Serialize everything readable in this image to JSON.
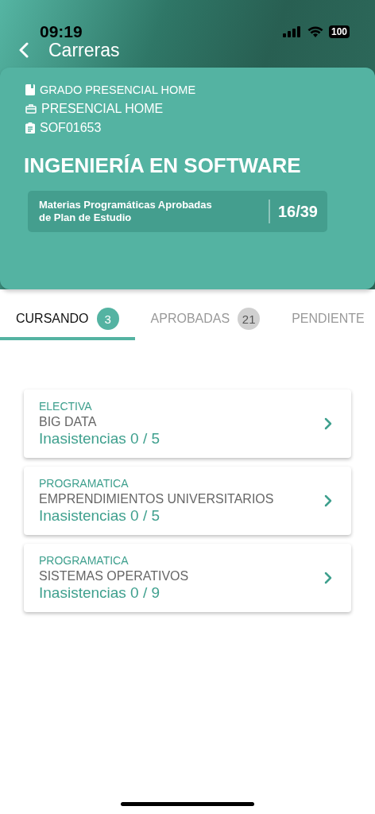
{
  "status_bar": {
    "time": "09:19",
    "battery": "100"
  },
  "nav": {
    "title": "Carreras"
  },
  "program": {
    "details": [
      {
        "kind": "book",
        "text": "GRADO PRESENCIAL HOME"
      },
      {
        "kind": "briefcase",
        "text": "PRESENCIAL HOME"
      },
      {
        "kind": "clipboard",
        "text": "SOF01653"
      }
    ],
    "name": "INGENIERÍA EN SOFTWARE",
    "summary": {
      "label_lines": [
        "Materias Programáticas Aprobadas",
        "de Plan de Estudio"
      ],
      "value": "16/39"
    }
  },
  "tabs": [
    {
      "label": "CURSANDO",
      "count": "3",
      "selected": true
    },
    {
      "label": "APROBADAS",
      "count": "21",
      "selected": false
    },
    {
      "label": "PENDIENTE",
      "selected": false
    }
  ],
  "courses": [
    {
      "type": "ELECTIVA",
      "name": "BIG DATA",
      "absences": "Inasistencias 0 / 5"
    },
    {
      "type": "PROGRAMATICA",
      "name": "EMPRENDIMIENTOS UNIVERSITARIOS",
      "absences": "Inasistencias 0 / 5"
    },
    {
      "type": "PROGRAMATICA",
      "name": "SISTEMAS OPERATIVOS",
      "absences": "Inasistencias 0 / 9"
    }
  ]
}
